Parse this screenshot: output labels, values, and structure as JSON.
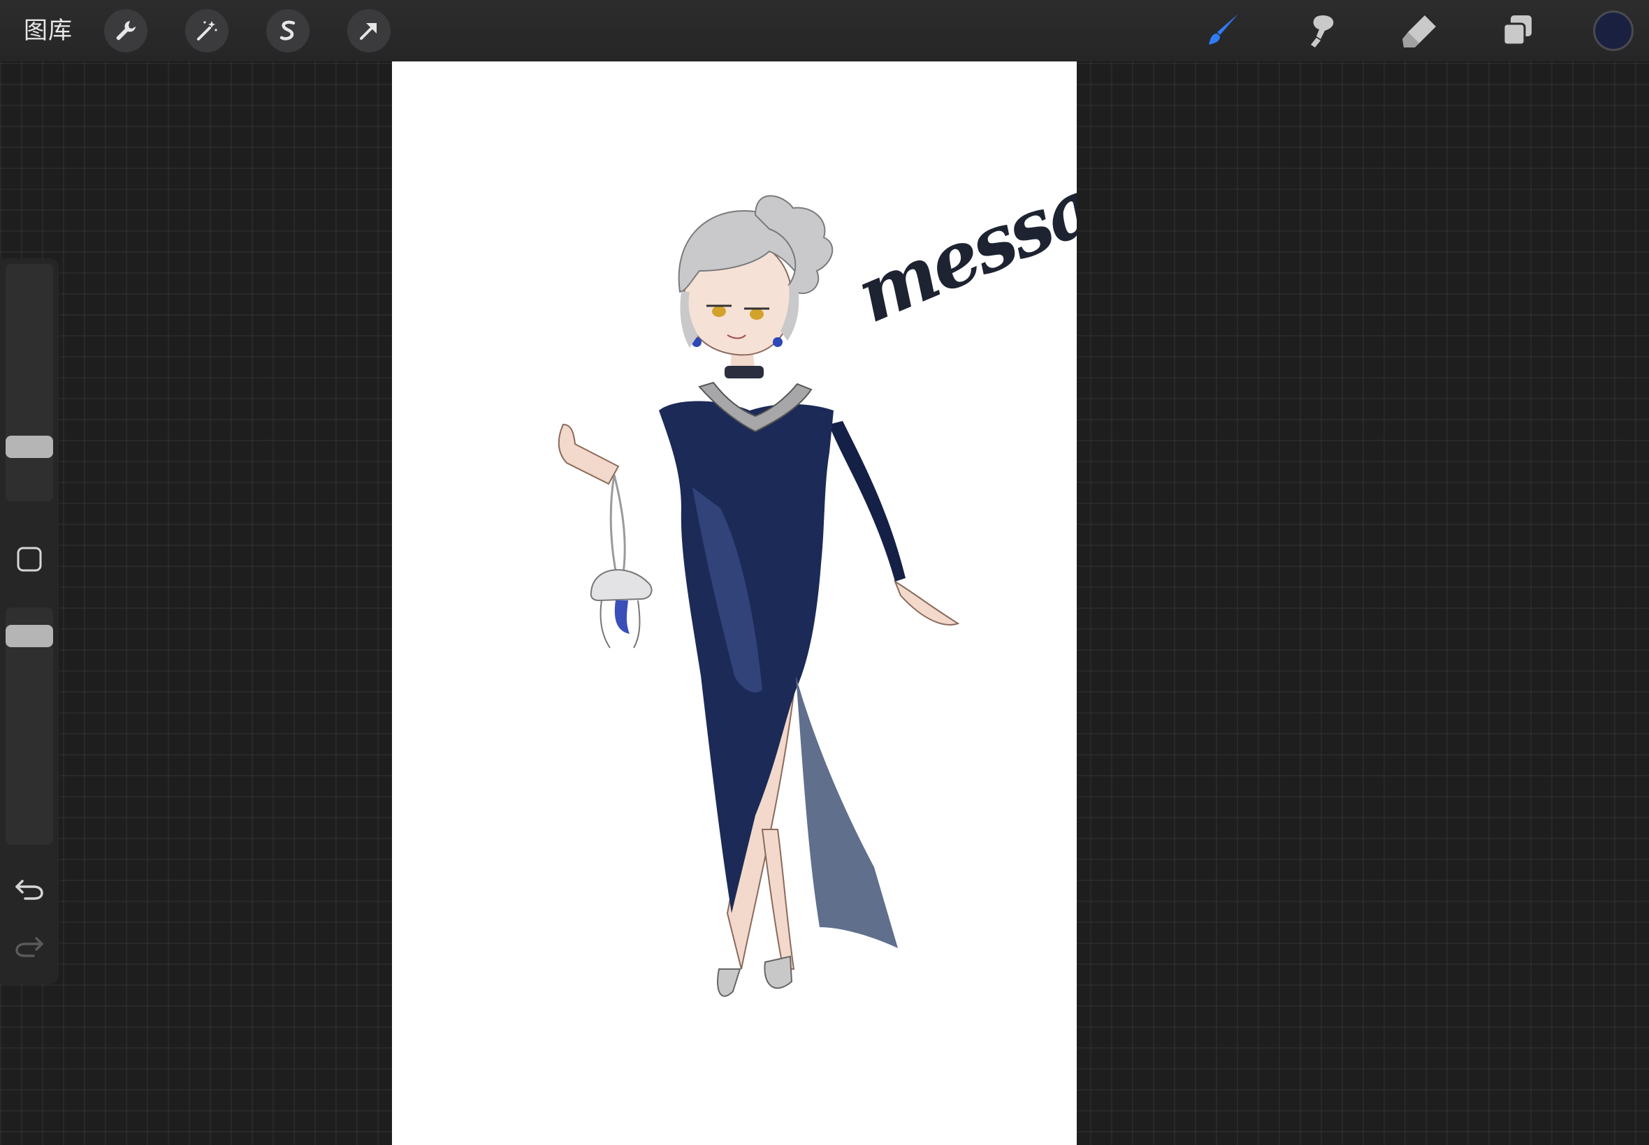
{
  "topbar": {
    "gallery_label": "图库",
    "left_tools": [
      "wrench-icon",
      "magic-wand-icon",
      "selection-s-icon",
      "transform-arrow-icon"
    ],
    "right_tools": [
      "brush-icon",
      "smudge-icon",
      "eraser-icon",
      "layers-icon"
    ],
    "active_tool": "brush-icon",
    "accent_color": "#2f7cf6",
    "current_color": "#1a2140"
  },
  "sidebar": {
    "brush_size_level": 0.2,
    "opacity_level": 0.92,
    "controls": [
      "modify-square-icon",
      "undo-icon",
      "redo-icon"
    ]
  },
  "canvas": {
    "background": "#ffffff",
    "signature_text": "messa",
    "dress_color": "#1c2a57",
    "hair_color": "#c9c9cb"
  }
}
